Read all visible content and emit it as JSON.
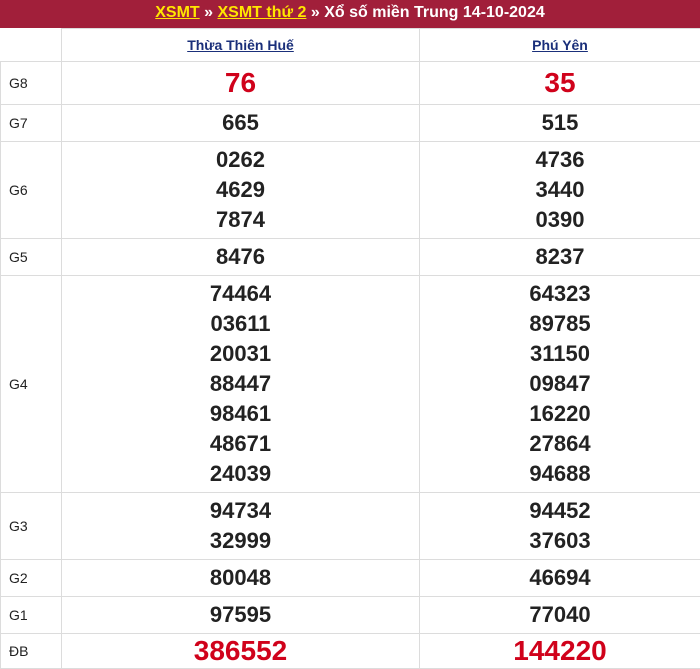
{
  "header": {
    "link1": "XSMT",
    "sep1": " » ",
    "link2": "XSMT thứ 2",
    "sep2": " » ",
    "title": "Xổ số miền Trung 14-10-2024"
  },
  "provinces": [
    "Thừa Thiên Huế",
    "Phú Yên"
  ],
  "prizes": [
    {
      "label": "G8",
      "cls": "r-g8",
      "values": [
        [
          "76"
        ],
        [
          "35"
        ]
      ]
    },
    {
      "label": "G7",
      "cls": "r-g7",
      "values": [
        [
          "665"
        ],
        [
          "515"
        ]
      ]
    },
    {
      "label": "G6",
      "cls": "r-g6",
      "values": [
        [
          "0262",
          "4629",
          "7874"
        ],
        [
          "4736",
          "3440",
          "0390"
        ]
      ]
    },
    {
      "label": "G5",
      "cls": "r-g5",
      "values": [
        [
          "8476"
        ],
        [
          "8237"
        ]
      ]
    },
    {
      "label": "G4",
      "cls": "r-g4",
      "values": [
        [
          "74464",
          "03611",
          "20031",
          "88447",
          "98461",
          "48671",
          "24039"
        ],
        [
          "64323",
          "89785",
          "31150",
          "09847",
          "16220",
          "27864",
          "94688"
        ]
      ]
    },
    {
      "label": "G3",
      "cls": "r-g3",
      "values": [
        [
          "94734",
          "32999"
        ],
        [
          "94452",
          "37603"
        ]
      ]
    },
    {
      "label": "G2",
      "cls": "r-g2",
      "values": [
        [
          "80048"
        ],
        [
          "46694"
        ]
      ]
    },
    {
      "label": "G1",
      "cls": "r-g1",
      "values": [
        [
          "97595"
        ],
        [
          "77040"
        ]
      ]
    },
    {
      "label": "ĐB",
      "cls": "r-db",
      "values": [
        [
          "386552"
        ],
        [
          "144220"
        ]
      ]
    }
  ]
}
